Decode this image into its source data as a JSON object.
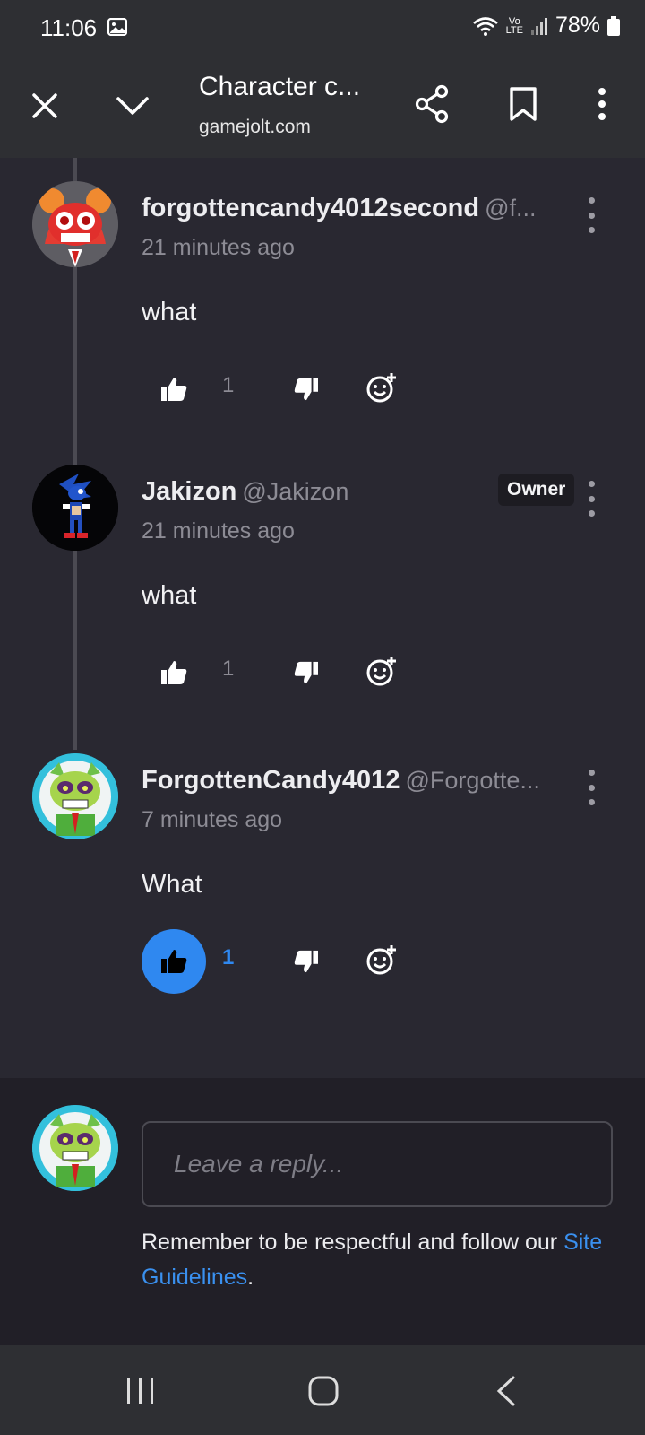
{
  "status_bar": {
    "time": "11:06",
    "battery": "78%",
    "network": "LTE"
  },
  "browser": {
    "title": "Character c...",
    "url": "gamejolt.com"
  },
  "comments": [
    {
      "username": "forgottencandy4012second",
      "handle": "@f...",
      "time": "21 minutes ago",
      "text": "what",
      "likes": "1",
      "liked": false,
      "badge": ""
    },
    {
      "username": "Jakizon",
      "handle": "@Jakizon",
      "time": "21 minutes ago",
      "text": "what",
      "likes": "1",
      "liked": false,
      "badge": "Owner"
    },
    {
      "username": "ForgottenCandy4012",
      "handle": "@Forgotte...",
      "time": "7 minutes ago",
      "text": "What",
      "likes": "1",
      "liked": true,
      "badge": ""
    }
  ],
  "reply": {
    "placeholder": "Leave a reply...",
    "notice": "Remember to be respectful and follow our ",
    "link": "Site Guidelines",
    "end": "."
  },
  "colors": {
    "accent": "#2f88f0",
    "background": "#292831",
    "bar": "#2e2f33"
  }
}
